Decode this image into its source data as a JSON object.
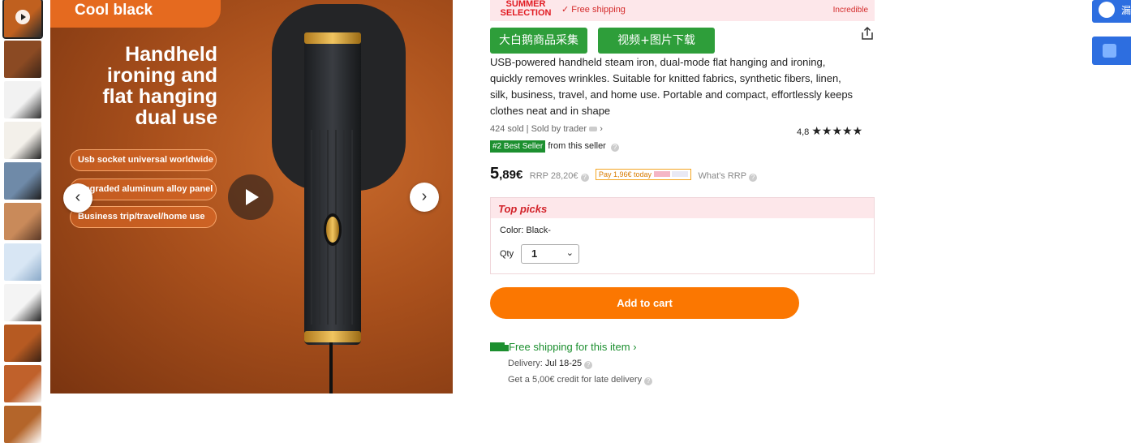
{
  "thumbnails": [
    {
      "name": "thumb-video",
      "colors": [
        "#c0601f",
        "#2a2a2a"
      ],
      "video": true
    },
    {
      "name": "thumb-2",
      "colors": [
        "#8b4a23",
        "#3a2418"
      ]
    },
    {
      "name": "thumb-3",
      "colors": [
        "#f2f2f2",
        "#2f2f2f"
      ]
    },
    {
      "name": "thumb-4",
      "colors": [
        "#f3f0ea",
        "#222"
      ]
    },
    {
      "name": "thumb-5",
      "colors": [
        "#6f8aa8",
        "#1e1e1e"
      ]
    },
    {
      "name": "thumb-6",
      "colors": [
        "#c98a5a",
        "#5a3826"
      ]
    },
    {
      "name": "thumb-7",
      "colors": [
        "#d8e6f4",
        "#8aa9c8"
      ]
    },
    {
      "name": "thumb-8",
      "colors": [
        "#f4f4f4",
        "#222"
      ]
    },
    {
      "name": "thumb-9",
      "colors": [
        "#b65a22",
        "#3b2214"
      ]
    },
    {
      "name": "thumb-10",
      "colors": [
        "#c0612b",
        "#f5f5f5"
      ]
    },
    {
      "name": "thumb-11",
      "colors": [
        "#b4652a",
        "#fff"
      ]
    }
  ],
  "hero": {
    "color_tag": "Cool black",
    "headline": [
      "Handheld",
      "ironing and",
      "flat hanging",
      "dual use"
    ],
    "pills": [
      "Usb socket universal worldwide",
      "Upgraded aluminum alloy panel",
      "Business trip/travel/home use"
    ],
    "prev_arrow": "‹",
    "next_arrow": "›"
  },
  "banner": {
    "summer_line1": "SUMMER",
    "summer_line2": "SELECTION",
    "free_shipping": "✓ Free shipping",
    "incredible": "Incredible"
  },
  "tool_buttons": [
    "大白鹅商品采集",
    "视频+图片下载"
  ],
  "product": {
    "title": "USB-powered handheld steam iron, dual-mode flat hanging and ironing, quickly removes wrinkles. Suitable for knitted fabrics, synthetic fibers, linen, silk, business, travel, and home use. Portable and compact, effortlessly keeps clothes neat and in shape",
    "sold": "424 sold",
    "sold_by": "Sold by trader",
    "rating": "4,8",
    "stars": "★★★★★",
    "best_badge": "#2 Best Seller",
    "best_text": "from this seller",
    "price_main": "5",
    "price_cents": ",89€",
    "rrp": "RRP 28,20€",
    "pay_box": "Pay 1,96€ today",
    "whats_rrp": "What's RRP"
  },
  "picks": {
    "heading": "Top picks",
    "color": "Color: Black-",
    "qty_label": "Qty",
    "qty_value": "1"
  },
  "cart": {
    "label": "Add to cart"
  },
  "shipping": {
    "title": "Free shipping for this item",
    "delivery_label": "Delivery: ",
    "delivery_date": "Jul 18-25",
    "credit": "Get a 5,00€ credit for late delivery"
  },
  "side": {
    "text": "漏"
  }
}
